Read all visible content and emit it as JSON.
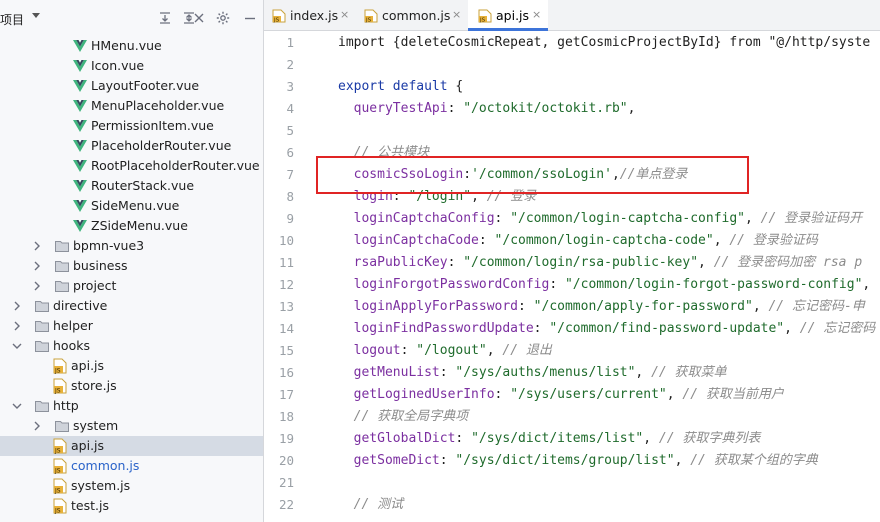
{
  "project_panel": {
    "title": "项目",
    "tree": [
      {
        "label": "HMenu.vue",
        "type": "vue",
        "indent": 4,
        "arrow": ""
      },
      {
        "label": "Icon.vue",
        "type": "vue",
        "indent": 4,
        "arrow": ""
      },
      {
        "label": "LayoutFooter.vue",
        "type": "vue",
        "indent": 4,
        "arrow": ""
      },
      {
        "label": "MenuPlaceholder.vue",
        "type": "vue",
        "indent": 4,
        "arrow": ""
      },
      {
        "label": "PermissionItem.vue",
        "type": "vue",
        "indent": 4,
        "arrow": ""
      },
      {
        "label": "PlaceholderRouter.vue",
        "type": "vue",
        "indent": 4,
        "arrow": ""
      },
      {
        "label": "RootPlaceholderRouter.vue",
        "type": "vue",
        "indent": 4,
        "arrow": ""
      },
      {
        "label": "RouterStack.vue",
        "type": "vue",
        "indent": 4,
        "arrow": ""
      },
      {
        "label": "SideMenu.vue",
        "type": "vue",
        "indent": 4,
        "arrow": ""
      },
      {
        "label": "ZSideMenu.vue",
        "type": "vue",
        "indent": 4,
        "arrow": ""
      },
      {
        "label": "bpmn-vue3",
        "type": "folder",
        "indent": 3,
        "arrow": "right"
      },
      {
        "label": "business",
        "type": "folder",
        "indent": 3,
        "arrow": "right"
      },
      {
        "label": "project",
        "type": "folder",
        "indent": 3,
        "arrow": "right"
      },
      {
        "label": "directive",
        "type": "folder",
        "indent": 2,
        "arrow": "right"
      },
      {
        "label": "helper",
        "type": "folder",
        "indent": 2,
        "arrow": "right"
      },
      {
        "label": "hooks",
        "type": "folder",
        "indent": 2,
        "arrow": "down"
      },
      {
        "label": "api.js",
        "type": "js",
        "indent": 3,
        "arrow": ""
      },
      {
        "label": "store.js",
        "type": "js",
        "indent": 3,
        "arrow": ""
      },
      {
        "label": "http",
        "type": "folder",
        "indent": 2,
        "arrow": "down"
      },
      {
        "label": "system",
        "type": "folder",
        "indent": 3,
        "arrow": "right"
      },
      {
        "label": "api.js",
        "type": "js",
        "indent": 3,
        "arrow": "",
        "selected": true
      },
      {
        "label": "common.js",
        "type": "js",
        "indent": 3,
        "arrow": "",
        "blue": true
      },
      {
        "label": "system.js",
        "type": "js",
        "indent": 3,
        "arrow": ""
      },
      {
        "label": "test.js",
        "type": "js",
        "indent": 3,
        "arrow": ""
      }
    ]
  },
  "tabs": [
    {
      "label": "index.js",
      "close": "×",
      "active": false
    },
    {
      "label": "common.js",
      "close": "×",
      "active": false
    },
    {
      "label": "api.js",
      "close": "×",
      "active": true
    }
  ],
  "editor": {
    "line_numbers": [
      "1",
      "2",
      "3",
      "4",
      "5",
      "6",
      "7",
      "8",
      "9",
      "10",
      "11",
      "12",
      "13",
      "14",
      "15",
      "16",
      "17",
      "18",
      "19",
      "20",
      "21",
      "22"
    ],
    "lines": [
      [
        {
          "t": "import {deleteCosmicRepeat, getCosmicProjectById} from \"@/http/syste",
          "c": "pl"
        }
      ],
      [],
      [
        {
          "t": "export default ",
          "c": "kw"
        },
        {
          "t": "{",
          "c": "pl"
        }
      ],
      [
        {
          "t": "  queryTestApi",
          "c": "key"
        },
        {
          "t": ": ",
          "c": "pl"
        },
        {
          "t": "\"/octokit/octokit.rb\"",
          "c": "str"
        },
        {
          "t": ",",
          "c": "pl"
        }
      ],
      [],
      [
        {
          "t": "  // 公共模块",
          "c": "cm"
        }
      ],
      [
        {
          "t": "  cosmicSsoLogin",
          "c": "key"
        },
        {
          "t": ":",
          "c": "pl"
        },
        {
          "t": "'/common/ssoLogin'",
          "c": "str"
        },
        {
          "t": ",",
          "c": "pl"
        },
        {
          "t": "//单点登录",
          "c": "cm"
        }
      ],
      [
        {
          "t": "  login",
          "c": "key"
        },
        {
          "t": ": ",
          "c": "pl"
        },
        {
          "t": "\"/login\"",
          "c": "str"
        },
        {
          "t": ", ",
          "c": "pl"
        },
        {
          "t": "// 登录",
          "c": "cm"
        }
      ],
      [
        {
          "t": "  loginCaptchaConfig",
          "c": "key"
        },
        {
          "t": ": ",
          "c": "pl"
        },
        {
          "t": "\"/common/login-captcha-config\"",
          "c": "str"
        },
        {
          "t": ", ",
          "c": "pl"
        },
        {
          "t": "// 登录验证码开",
          "c": "cm"
        }
      ],
      [
        {
          "t": "  loginCaptchaCode",
          "c": "key"
        },
        {
          "t": ": ",
          "c": "pl"
        },
        {
          "t": "\"/common/login-captcha-code\"",
          "c": "str"
        },
        {
          "t": ", ",
          "c": "pl"
        },
        {
          "t": "// 登录验证码",
          "c": "cm"
        }
      ],
      [
        {
          "t": "  rsaPublicKey",
          "c": "key"
        },
        {
          "t": ": ",
          "c": "pl"
        },
        {
          "t": "\"/common/login/rsa-public-key\"",
          "c": "str"
        },
        {
          "t": ", ",
          "c": "pl"
        },
        {
          "t": "// 登录密码加密 rsa p",
          "c": "cm"
        }
      ],
      [
        {
          "t": "  loginForgotPasswordConfig",
          "c": "key"
        },
        {
          "t": ": ",
          "c": "pl"
        },
        {
          "t": "\"/common/login-forgot-password-config\"",
          "c": "str"
        },
        {
          "t": ",",
          "c": "pl"
        }
      ],
      [
        {
          "t": "  loginApplyForPassword",
          "c": "key"
        },
        {
          "t": ": ",
          "c": "pl"
        },
        {
          "t": "\"/common/apply-for-password\"",
          "c": "str"
        },
        {
          "t": ", ",
          "c": "pl"
        },
        {
          "t": "// 忘记密码-申",
          "c": "cm"
        }
      ],
      [
        {
          "t": "  loginFindPasswordUpdate",
          "c": "key"
        },
        {
          "t": ": ",
          "c": "pl"
        },
        {
          "t": "\"/common/find-password-update\"",
          "c": "str"
        },
        {
          "t": ", ",
          "c": "pl"
        },
        {
          "t": "// 忘记密码",
          "c": "cm"
        }
      ],
      [
        {
          "t": "  logout",
          "c": "key"
        },
        {
          "t": ": ",
          "c": "pl"
        },
        {
          "t": "\"/logout\"",
          "c": "str"
        },
        {
          "t": ", ",
          "c": "pl"
        },
        {
          "t": "// 退出",
          "c": "cm"
        }
      ],
      [
        {
          "t": "  getMenuList",
          "c": "key"
        },
        {
          "t": ": ",
          "c": "pl"
        },
        {
          "t": "\"/sys/auths/menus/list\"",
          "c": "str"
        },
        {
          "t": ", ",
          "c": "pl"
        },
        {
          "t": "// 获取菜单",
          "c": "cm"
        }
      ],
      [
        {
          "t": "  getLoginedUserInfo",
          "c": "key"
        },
        {
          "t": ": ",
          "c": "pl"
        },
        {
          "t": "\"/sys/users/current\"",
          "c": "str"
        },
        {
          "t": ", ",
          "c": "pl"
        },
        {
          "t": "// 获取当前用户",
          "c": "cm"
        }
      ],
      [
        {
          "t": "  // 获取全局字典项",
          "c": "cm"
        }
      ],
      [
        {
          "t": "  getGlobalDict",
          "c": "key"
        },
        {
          "t": ": ",
          "c": "pl"
        },
        {
          "t": "\"/sys/dict/items/list\"",
          "c": "str"
        },
        {
          "t": ", ",
          "c": "pl"
        },
        {
          "t": "// 获取字典列表",
          "c": "cm"
        }
      ],
      [
        {
          "t": "  getSomeDict",
          "c": "key"
        },
        {
          "t": ": ",
          "c": "pl"
        },
        {
          "t": "\"/sys/dict/items/group/list\"",
          "c": "str"
        },
        {
          "t": ", ",
          "c": "pl"
        },
        {
          "t": "// 获取某个组的字典",
          "c": "cm"
        }
      ],
      [],
      [
        {
          "t": "  // 测试",
          "c": "cm"
        }
      ]
    ]
  },
  "colors": {
    "accent": "#3d74d9",
    "highlight_box": "#e02424",
    "selection": "#d5dbe4",
    "vue_icon": "#3fb47e",
    "js_icon": "#e8b23a"
  },
  "icons": [
    "collapse-all-icon",
    "expand-all-icon",
    "close-panel-icon",
    "gear-icon",
    "minimize-icon",
    "vue-file-icon",
    "js-file-icon",
    "folder-icon"
  ]
}
